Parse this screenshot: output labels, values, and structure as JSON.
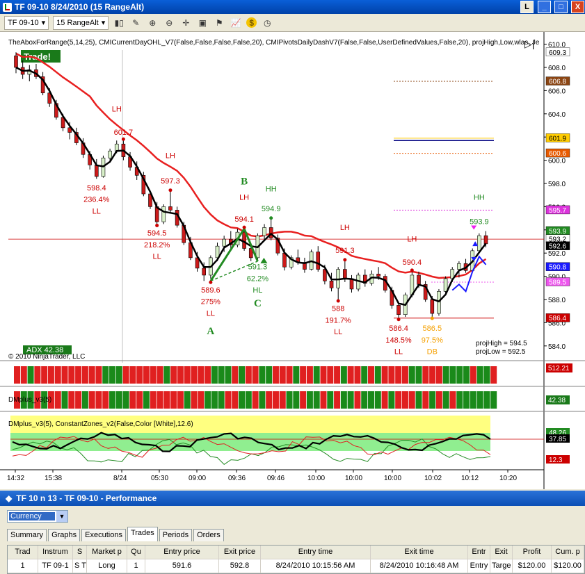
{
  "window": {
    "title": "TF 09-10  8/24/2010 (15 RangeAlt)",
    "buttons": [
      "L",
      "_",
      "□",
      "X"
    ]
  },
  "toolbar": {
    "instrument": "TF 09-10",
    "interval": "15 RangeAlt"
  },
  "chart": {
    "indicator_line": "TheAboxForRange(5,14,25), CMICurrentDayOHL_V7(False,False,False,False,20), CMIPivotsDailyDashV7(False,False,UserDefinedValues,False,20), projHigh,Low,wlas, Je",
    "trade_label": "Trade!",
    "price_ticks": [
      "610.0",
      "608.0",
      "606.0",
      "604.0",
      "602.0",
      "600.0",
      "598.0",
      "596.0",
      "594.0",
      "592.0",
      "590.0",
      "588.0",
      "586.0",
      "584.0"
    ],
    "price_boxes": [
      {
        "label": "609.3",
        "color": "#ffffff",
        "text": "#000000",
        "v": 609.3
      },
      {
        "label": "606.8",
        "color": "#8b4513",
        "text": "#ffffff",
        "v": 606.8
      },
      {
        "label": "601.9",
        "color": "#ffcc00",
        "text": "#000000",
        "v": 601.9
      },
      {
        "label": "600.6",
        "color": "#e85a00",
        "text": "#ffffff",
        "v": 600.6
      },
      {
        "label": "595.7",
        "color": "#dd33dd",
        "text": "#ffffff",
        "v": 595.7
      },
      {
        "label": "593.9",
        "color": "#228b22",
        "text": "#ffffff",
        "v": 593.9
      },
      {
        "label": "593.2",
        "color": "#ffffff",
        "text": "#000000",
        "v": 593.2
      },
      {
        "label": "592.6",
        "color": "#000000",
        "text": "#ffffff",
        "v": 592.6
      },
      {
        "label": "590.8",
        "color": "#1a1aff",
        "text": "#ffffff",
        "v": 590.8
      },
      {
        "label": "589.5",
        "color": "#ee55ee",
        "text": "#ffffff",
        "v": 589.5
      },
      {
        "label": "586.4",
        "color": "#cc0000",
        "text": "#ffffff",
        "v": 586.4
      }
    ],
    "annotations": [
      {
        "t": "LH",
        "c": "#cc0000",
        "i": 15,
        "v": 604.2
      },
      {
        "t": "601.7",
        "c": "#cc0000",
        "i": 16,
        "v": 602.2
      },
      {
        "t": "598.4",
        "c": "#cc0000",
        "i": 12,
        "v": 597.4
      },
      {
        "t": "236.4%",
        "c": "#cc0000",
        "i": 12,
        "v": 596.4
      },
      {
        "t": "LL",
        "c": "#cc0000",
        "i": 12,
        "v": 595.4
      },
      {
        "t": "LH",
        "c": "#cc0000",
        "i": 23,
        "v": 600.2
      },
      {
        "t": "597.3",
        "c": "#cc0000",
        "i": 23,
        "v": 598.0
      },
      {
        "t": "594.5",
        "c": "#cc0000",
        "i": 21,
        "v": 593.5
      },
      {
        "t": "218.2%",
        "c": "#cc0000",
        "i": 21,
        "v": 592.5
      },
      {
        "t": "LL",
        "c": "#cc0000",
        "i": 21,
        "v": 591.5
      },
      {
        "t": "B",
        "c": "#228b22",
        "i": 34,
        "v": 597.9
      },
      {
        "t": "LH",
        "c": "#cc0000",
        "i": 34,
        "v": 596.6
      },
      {
        "t": "HH",
        "c": "#228b22",
        "i": 38,
        "v": 597.3
      },
      {
        "t": "594.1",
        "c": "#cc0000",
        "i": 34,
        "v": 594.7
      },
      {
        "t": "594.9",
        "c": "#228b22",
        "i": 38,
        "v": 595.6
      },
      {
        "t": "591.3",
        "c": "#228b22",
        "i": 36,
        "v": 590.6
      },
      {
        "t": "62.2%",
        "c": "#228b22",
        "i": 36,
        "v": 589.6
      },
      {
        "t": "HL",
        "c": "#228b22",
        "i": 36,
        "v": 588.6
      },
      {
        "t": "C",
        "c": "#228b22",
        "i": 36,
        "v": 587.4
      },
      {
        "t": "589.6",
        "c": "#cc0000",
        "i": 29,
        "v": 588.6
      },
      {
        "t": "275%",
        "c": "#cc0000",
        "i": 29,
        "v": 587.6
      },
      {
        "t": "LL",
        "c": "#cc0000",
        "i": 29,
        "v": 586.6
      },
      {
        "t": "A",
        "c": "#228b22",
        "i": 29,
        "v": 585.0
      },
      {
        "t": "LH",
        "c": "#cc0000",
        "i": 49,
        "v": 594.0
      },
      {
        "t": "591.3",
        "c": "#cc0000",
        "i": 49,
        "v": 592.0
      },
      {
        "t": "588",
        "c": "#cc0000",
        "i": 48,
        "v": 587.0
      },
      {
        "t": "191.7%",
        "c": "#cc0000",
        "i": 48,
        "v": 586.0
      },
      {
        "t": "LL",
        "c": "#cc0000",
        "i": 48,
        "v": 585.0
      },
      {
        "t": "LH",
        "c": "#cc0000",
        "i": 59,
        "v": 593.0
      },
      {
        "t": "590.4",
        "c": "#cc0000",
        "i": 59,
        "v": 591.0
      },
      {
        "t": "586.4",
        "c": "#cc0000",
        "i": 57,
        "v": 585.3
      },
      {
        "t": "148.5%",
        "c": "#cc0000",
        "i": 57,
        "v": 584.3
      },
      {
        "t": "LL",
        "c": "#cc0000",
        "i": 57,
        "v": 583.3
      },
      {
        "t": "586.5",
        "c": "#f5a000",
        "i": 62,
        "v": 585.3
      },
      {
        "t": "97.5%",
        "c": "#f5a000",
        "i": 62,
        "v": 584.3
      },
      {
        "t": "DB",
        "c": "#f5a000",
        "i": 62,
        "v": 583.3
      },
      {
        "t": "HH",
        "c": "#228b22",
        "i": 69,
        "v": 596.6
      },
      {
        "t": "593.9",
        "c": "#228b22",
        "i": 69,
        "v": 594.5
      }
    ],
    "proj": [
      "projHigh = 594.5",
      "projLow = 592.5"
    ],
    "adx": "ADX 42.38",
    "copyright": "© 2010 NinjaTrader, LLC",
    "pane2_value": "512.21",
    "pane3_label": "DMplus_v3(5)",
    "pane3_value": "42.38",
    "pane4_label": "DMplus_v3(5), ConstantZones_v2(False,Color [White],12.6)",
    "pane4_values": [
      {
        "label": "48.26",
        "color": "#228b22"
      },
      {
        "label": "37.85",
        "color": "#000000"
      },
      {
        "label": "12.3",
        "color": "#cc0000"
      }
    ],
    "time_ticks": [
      "14:32",
      "15:38",
      "8/24",
      "05:30",
      "09:00",
      "09:36",
      "09:46",
      "10:00",
      "10:00",
      "10:00",
      "10:02",
      "10:12",
      "10:20"
    ],
    "bars": [
      [
        609.0,
        609.3,
        607.5,
        608.0
      ],
      [
        608.0,
        608.6,
        607.0,
        607.4
      ],
      [
        607.4,
        608.2,
        606.8,
        607.8
      ],
      [
        607.8,
        608.3,
        607.0,
        607.2
      ],
      [
        607.2,
        607.6,
        605.6,
        605.8
      ],
      [
        605.8,
        606.2,
        604.6,
        604.9
      ],
      [
        604.9,
        605.2,
        603.5,
        603.7
      ],
      [
        603.7,
        604.0,
        602.5,
        602.8
      ],
      [
        602.8,
        603.3,
        601.8,
        602.4
      ],
      [
        602.4,
        602.8,
        601.3,
        601.5
      ],
      [
        601.5,
        601.9,
        600.2,
        600.5
      ],
      [
        600.5,
        600.8,
        599.2,
        599.6
      ],
      [
        599.6,
        600.1,
        598.4,
        598.6
      ],
      [
        598.6,
        600.4,
        598.5,
        600.2
      ],
      [
        600.2,
        601.0,
        599.9,
        600.8
      ],
      [
        600.8,
        601.7,
        600.6,
        601.4
      ],
      [
        601.4,
        601.7,
        600.0,
        600.3
      ],
      [
        600.3,
        600.7,
        599.1,
        599.4
      ],
      [
        599.4,
        599.9,
        598.3,
        598.7
      ],
      [
        598.7,
        599.0,
        596.9,
        597.1
      ],
      [
        597.1,
        597.4,
        595.8,
        596.0
      ],
      [
        596.0,
        596.4,
        594.5,
        594.7
      ],
      [
        594.7,
        596.2,
        594.5,
        596.0
      ],
      [
        596.0,
        597.3,
        595.5,
        595.7
      ],
      [
        595.7,
        596.0,
        594.2,
        594.4
      ],
      [
        594.4,
        594.7,
        592.7,
        592.9
      ],
      [
        592.9,
        593.4,
        591.4,
        591.6
      ],
      [
        591.6,
        592.1,
        590.4,
        590.7
      ],
      [
        590.7,
        591.2,
        589.6,
        590.1
      ],
      [
        590.1,
        591.8,
        589.8,
        591.6
      ],
      [
        591.6,
        592.9,
        591.3,
        592.6
      ],
      [
        592.6,
        593.5,
        592.1,
        593.2
      ],
      [
        593.2,
        593.9,
        592.4,
        592.7
      ],
      [
        592.7,
        594.1,
        592.5,
        593.8
      ],
      [
        593.8,
        594.1,
        592.2,
        592.4
      ],
      [
        592.4,
        592.8,
        591.3,
        591.6
      ],
      [
        591.6,
        593.7,
        591.4,
        593.5
      ],
      [
        593.5,
        594.5,
        593.0,
        594.2
      ],
      [
        594.2,
        594.9,
        593.1,
        593.3
      ],
      [
        593.3,
        593.6,
        591.8,
        592.0
      ],
      [
        592.0,
        592.4,
        590.5,
        590.8
      ],
      [
        590.8,
        591.8,
        590.6,
        591.6
      ],
      [
        591.6,
        592.3,
        591.0,
        591.2
      ],
      [
        591.2,
        591.6,
        590.3,
        590.6
      ],
      [
        590.6,
        592.3,
        590.5,
        592.1
      ],
      [
        592.1,
        592.6,
        590.4,
        590.6
      ],
      [
        590.6,
        591.0,
        589.3,
        589.6
      ],
      [
        589.6,
        590.3,
        588.7,
        589.0
      ],
      [
        589.0,
        590.8,
        588.0,
        590.6
      ],
      [
        590.6,
        591.3,
        589.5,
        589.8
      ],
      [
        589.8,
        590.1,
        588.6,
        588.9
      ],
      [
        588.9,
        590.3,
        588.7,
        590.1
      ],
      [
        590.1,
        590.6,
        589.1,
        589.4
      ],
      [
        589.4,
        590.5,
        589.2,
        590.2
      ],
      [
        590.2,
        590.8,
        589.7,
        590.0
      ],
      [
        590.0,
        590.2,
        588.6,
        588.8
      ],
      [
        588.8,
        589.1,
        587.2,
        587.5
      ],
      [
        587.5,
        587.8,
        586.4,
        586.7
      ],
      [
        586.7,
        588.6,
        586.5,
        588.4
      ],
      [
        588.4,
        590.4,
        588.2,
        590.1
      ],
      [
        590.1,
        590.4,
        589.0,
        589.3
      ],
      [
        589.3,
        589.6,
        587.8,
        588.0
      ],
      [
        588.0,
        588.3,
        586.5,
        586.8
      ],
      [
        586.8,
        588.9,
        586.6,
        588.7
      ],
      [
        588.7,
        590.0,
        588.5,
        589.8
      ],
      [
        589.8,
        590.8,
        589.5,
        590.6
      ],
      [
        590.6,
        591.3,
        589.9,
        591.1
      ],
      [
        591.1,
        591.5,
        590.3,
        590.5
      ],
      [
        590.5,
        592.4,
        590.4,
        592.2
      ],
      [
        592.2,
        593.7,
        592.0,
        593.5
      ],
      [
        593.5,
        593.9,
        592.5,
        592.8
      ]
    ]
  },
  "perf": {
    "title": "TF 10 n 13 - TF 09-10 - Performance",
    "currency": "Currency",
    "tabs": [
      "Summary",
      "Graphs",
      "Executions",
      "Trades",
      "Periods",
      "Orders"
    ],
    "columns": [
      "Trad",
      "Instrum",
      "S",
      "Market p",
      "Qu",
      "Entry price",
      "Exit price",
      "Entry time",
      "Exit time",
      "Entr",
      "Exit",
      "Profit",
      "Cum. p"
    ],
    "row": [
      "1",
      "TF 09-1",
      "S TF",
      "Long",
      "1",
      "591.6",
      "592.8",
      "8/24/2010 10:15:56 AM",
      "8/24/2010 10:16:48 AM",
      "Entry",
      "Targe",
      "$120.00",
      "$120.00"
    ]
  }
}
